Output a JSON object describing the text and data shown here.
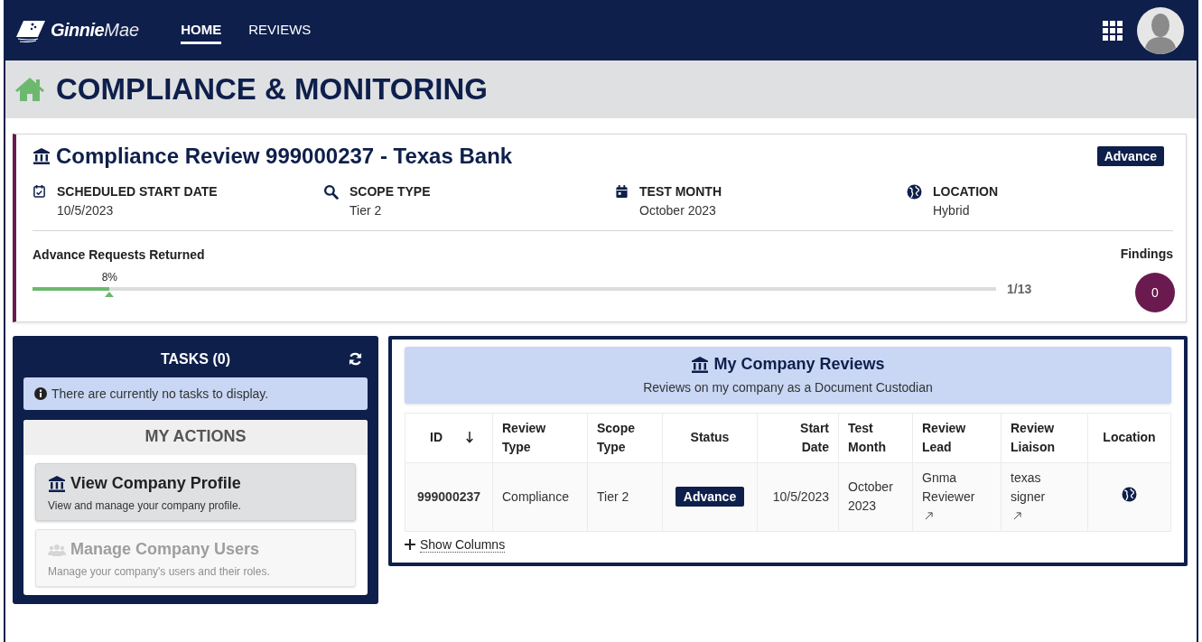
{
  "nav": {
    "logo": {
      "bold": "Ginnie",
      "light": "Mae"
    },
    "tabs": [
      {
        "label": "HOME",
        "selected": true
      },
      {
        "label": "REVIEWS",
        "selected": false
      }
    ]
  },
  "page_title": "COMPLIANCE & MONITORING",
  "review": {
    "title": "Compliance Review 999000237 - Texas Bank",
    "status": "Advance",
    "fields": [
      {
        "kind": "calendar-check",
        "label": "SCHEDULED START DATE",
        "value": "10/5/2023"
      },
      {
        "kind": "search",
        "label": "SCOPE TYPE",
        "value": "Tier 2"
      },
      {
        "kind": "calendar",
        "label": "TEST MONTH",
        "value": "October 2023"
      },
      {
        "kind": "globe",
        "label": "LOCATION",
        "value": "Hybrid"
      }
    ],
    "progress": {
      "label": "Advance Requests Returned",
      "percent": "8%",
      "level": 0.08,
      "count": "1/13"
    },
    "findings": {
      "label": "Findings",
      "count": "0"
    }
  },
  "tasks": {
    "title": "TASKS (0)",
    "message": "There are currently no tasks to display.",
    "actions_title": "MY ACTIONS",
    "actions": [
      {
        "kind": "bank",
        "title": "View Company Profile",
        "description": "View and manage your company profile.",
        "disabled": false
      },
      {
        "kind": "users",
        "title": "Manage Company Users",
        "description": "Manage your company's users and their roles.",
        "disabled": true
      }
    ]
  },
  "reviews": {
    "title": "My Company Reviews",
    "subtitle": "Reviews on my company as a Document Custodian",
    "columns": [
      {
        "label": "ID",
        "sorted": true
      },
      {
        "label": "Review Type",
        "sorted": false
      },
      {
        "label": "Scope Type",
        "sorted": false
      },
      {
        "label": "Status",
        "sorted": false
      },
      {
        "label": "Start Date",
        "sorted": false
      },
      {
        "label": "Test Month",
        "sorted": false
      },
      {
        "label": "Review Lead",
        "sorted": false
      },
      {
        "label": "Review Liaison",
        "sorted": false
      },
      {
        "label": "Location",
        "sorted": false
      }
    ],
    "rows": [
      {
        "cells": [
          {
            "kind": "id",
            "text": "999000237"
          },
          {
            "kind": "text",
            "text": "Compliance"
          },
          {
            "kind": "text",
            "text": "Tier 2"
          },
          {
            "kind": "badge",
            "text": "Advance"
          },
          {
            "kind": "date",
            "text": "10/5/2023"
          },
          {
            "kind": "text",
            "text": "October 2023"
          },
          {
            "kind": "link",
            "text": "Gnma Reviewer"
          },
          {
            "kind": "link",
            "text": "texas signer"
          },
          {
            "kind": "globe"
          }
        ]
      }
    ],
    "show_columns": "Show Columns"
  }
}
